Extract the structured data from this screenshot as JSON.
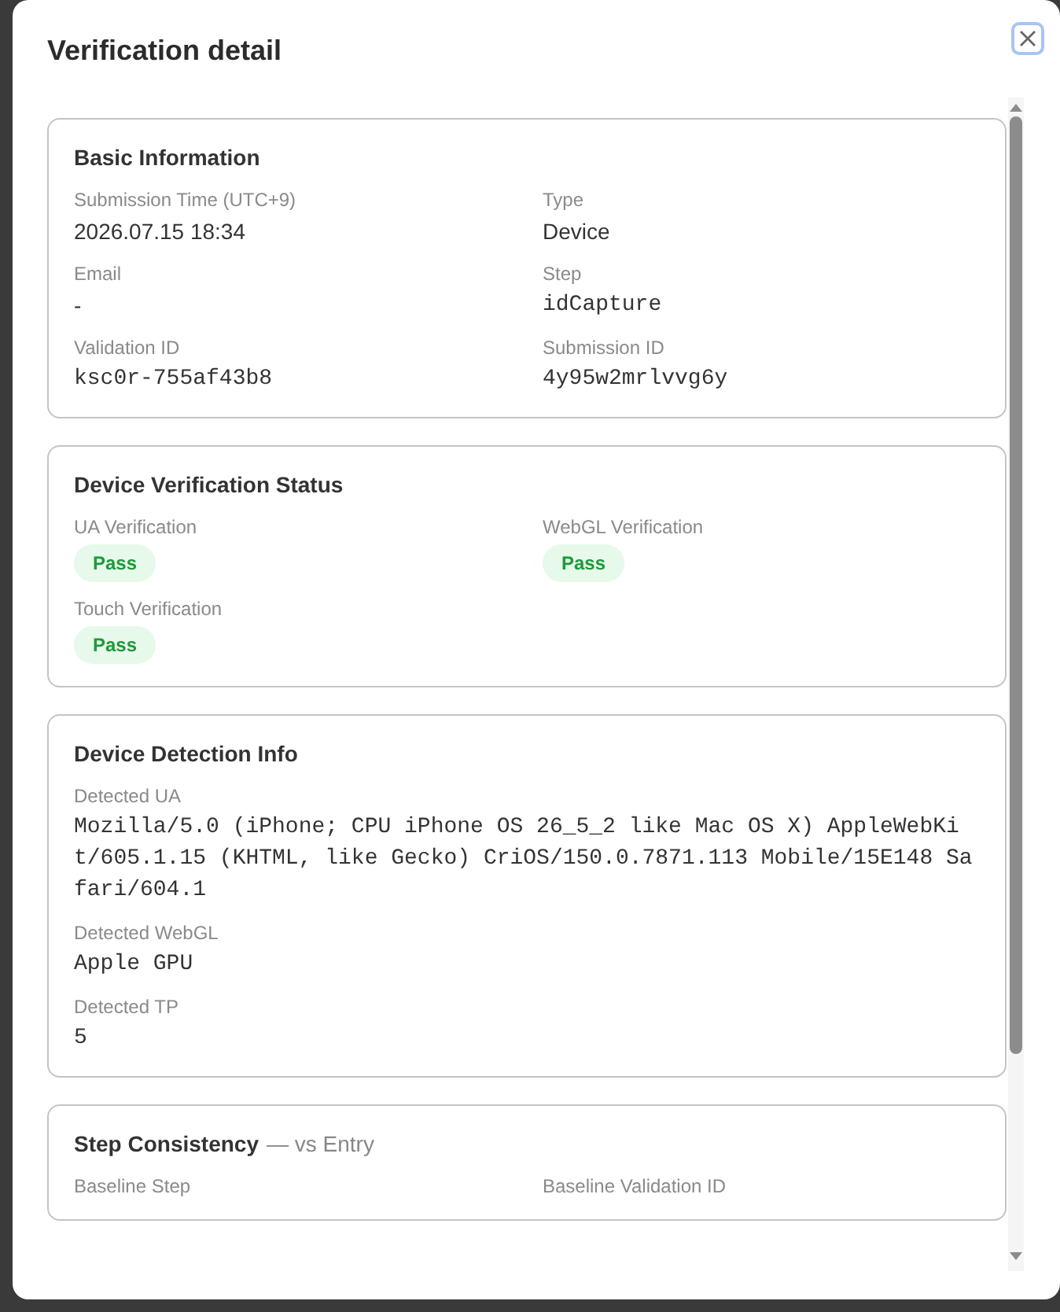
{
  "dialog": {
    "title": "Verification detail"
  },
  "sections": [
    {
      "title": "Basic Information",
      "fields": [
        {
          "label": "Submission Time (UTC+9)",
          "kind": "text",
          "value": "2026.07.15 18:34"
        },
        {
          "label": "Type",
          "kind": "text",
          "value": "Device"
        },
        {
          "label": "Email",
          "kind": "text",
          "value": "-"
        },
        {
          "label": "Step",
          "kind": "mono",
          "value": "idCapture"
        },
        {
          "label": "Validation ID",
          "kind": "mono",
          "value": "ksc0r-755af43b8"
        },
        {
          "label": "Submission ID",
          "kind": "mono",
          "value": "4y95w2mrlvvg6y"
        }
      ]
    },
    {
      "title": "Device Verification Status",
      "fields": [
        {
          "label": "UA Verification",
          "kind": "badge",
          "value": "Pass"
        },
        {
          "label": "WebGL Verification",
          "kind": "badge",
          "value": "Pass"
        },
        {
          "label": "Touch Verification",
          "kind": "badge",
          "value": "Pass"
        }
      ]
    },
    {
      "title": "Device Detection Info",
      "fields": [
        {
          "label": "Detected UA",
          "kind": "mono",
          "wide": true,
          "value": "Mozilla/5.0 (iPhone; CPU iPhone OS 26_5_2 like Mac OS X) AppleWebKit/605.1.15 (KHTML, like Gecko) CriOS/150.0.7871.113 Mobile/15E148 Safari/604.1"
        },
        {
          "label": "Detected WebGL",
          "kind": "mono",
          "wide": true,
          "value": "Apple GPU"
        },
        {
          "label": "Detected TP",
          "kind": "mono",
          "wide": true,
          "value": "5"
        }
      ]
    },
    {
      "title": "Step Consistency",
      "subtitle": "— vs Entry",
      "fields": [
        {
          "label": "Baseline Step",
          "kind": "none"
        },
        {
          "label": "Baseline Validation ID",
          "kind": "none"
        }
      ]
    }
  ]
}
